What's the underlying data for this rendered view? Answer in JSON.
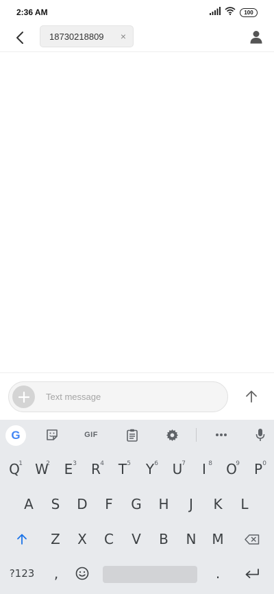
{
  "status_bar": {
    "time": "2:36 AM",
    "battery": "100",
    "icons": [
      "signal-icon",
      "wifi-icon",
      "battery-icon"
    ]
  },
  "header": {
    "back_icon": "back-arrow-icon",
    "recipient": "18730218809",
    "chip_close": "×",
    "contact_icon": "person-icon"
  },
  "composer": {
    "placeholder": "Text message",
    "add_icon": "plus-icon",
    "send_icon": "send-arrow-icon"
  },
  "keyboard": {
    "toolbar": {
      "google_logo": "G",
      "sticker_icon": "sticker-icon",
      "gif_label": "GIF",
      "clipboard_icon": "clipboard-icon",
      "settings_icon": "gear-icon",
      "more_icon": "more-icon",
      "mic_icon": "mic-icon"
    },
    "row1": [
      {
        "key": "Q",
        "hint": "1"
      },
      {
        "key": "W",
        "hint": "2"
      },
      {
        "key": "E",
        "hint": "3"
      },
      {
        "key": "R",
        "hint": "4"
      },
      {
        "key": "T",
        "hint": "5"
      },
      {
        "key": "Y",
        "hint": "6"
      },
      {
        "key": "U",
        "hint": "7"
      },
      {
        "key": "I",
        "hint": "8"
      },
      {
        "key": "O",
        "hint": "9"
      },
      {
        "key": "P",
        "hint": "0"
      }
    ],
    "row2": [
      "A",
      "S",
      "D",
      "F",
      "G",
      "H",
      "J",
      "K",
      "L"
    ],
    "row3": [
      "Z",
      "X",
      "C",
      "V",
      "B",
      "N",
      "M"
    ],
    "bottom": {
      "symbols": "?123",
      "comma": ",",
      "period": ".",
      "emoji_icon": "emoji-icon",
      "enter_icon": "enter-icon"
    },
    "colors": {
      "background": "#e8eaed",
      "shift_accent": "#1a73e8",
      "key_text": "#3c4043"
    }
  }
}
